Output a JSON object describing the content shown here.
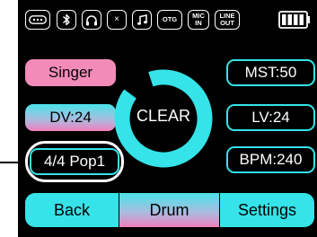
{
  "status_bar": {
    "icons": [
      {
        "name": "keyboard-icon"
      },
      {
        "name": "bluetooth-icon"
      },
      {
        "name": "headphones-icon"
      },
      {
        "name": "mute-icon",
        "label": "×"
      },
      {
        "name": "music-note-icon"
      },
      {
        "name": "otg-icon",
        "label": "OTG"
      },
      {
        "name": "mic-in-icon",
        "line1": "MIC",
        "line2": "IN"
      },
      {
        "name": "line-out-icon",
        "line1": "LINE",
        "line2": "OUT"
      },
      {
        "name": "battery-icon",
        "level": 1.0
      }
    ]
  },
  "left_buttons": {
    "singer": "Singer",
    "dv": "DV:24",
    "style": "4/4 Pop1"
  },
  "right_buttons": {
    "mst": "MST:50",
    "lv": "LV:24",
    "bpm": "BPM:240"
  },
  "center": {
    "label": "CLEAR",
    "ring_progress": 0.9
  },
  "bottom_bar": {
    "back": "Back",
    "drum": "Drum",
    "settings": "Settings"
  },
  "colors": {
    "accent_cyan": "#35e3e8",
    "accent_pink": "#f38bb8",
    "background": "#000000",
    "highlight": "#ffffff"
  }
}
